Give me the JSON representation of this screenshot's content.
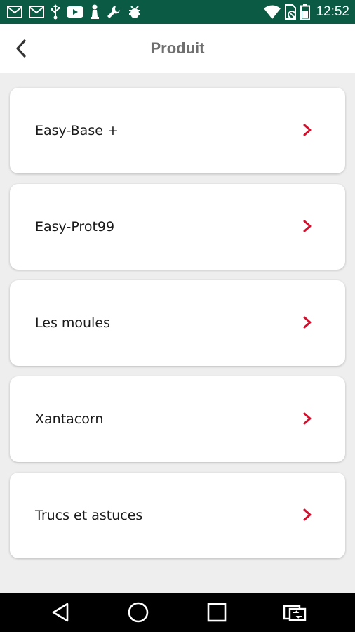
{
  "status_bar": {
    "time": "12:52",
    "icons": [
      "gmail-icon",
      "gmail-icon",
      "usb-icon",
      "youtube-icon",
      "chess-pawn-icon",
      "wrench-icon",
      "bug-icon",
      "wifi-icon",
      "no-sim-icon",
      "battery-icon"
    ],
    "background_color": "#0b5a44"
  },
  "app_bar": {
    "back_icon": "chevron-left-icon",
    "title": "Produit"
  },
  "items": [
    {
      "label": "Easy-Base +",
      "icon": "chevron-right-icon"
    },
    {
      "label": "Easy-Prot99",
      "icon": "chevron-right-icon"
    },
    {
      "label": "Les moules",
      "icon": "chevron-right-icon"
    },
    {
      "label": "Xantacorn",
      "icon": "chevron-right-icon"
    },
    {
      "label": "Trucs et astuces",
      "icon": "chevron-right-icon"
    }
  ],
  "accent_color": "#d0102c",
  "nav_bar": {
    "buttons": [
      "back-triangle-icon",
      "home-circle-icon",
      "recents-square-icon",
      "switch-app-icon"
    ]
  }
}
